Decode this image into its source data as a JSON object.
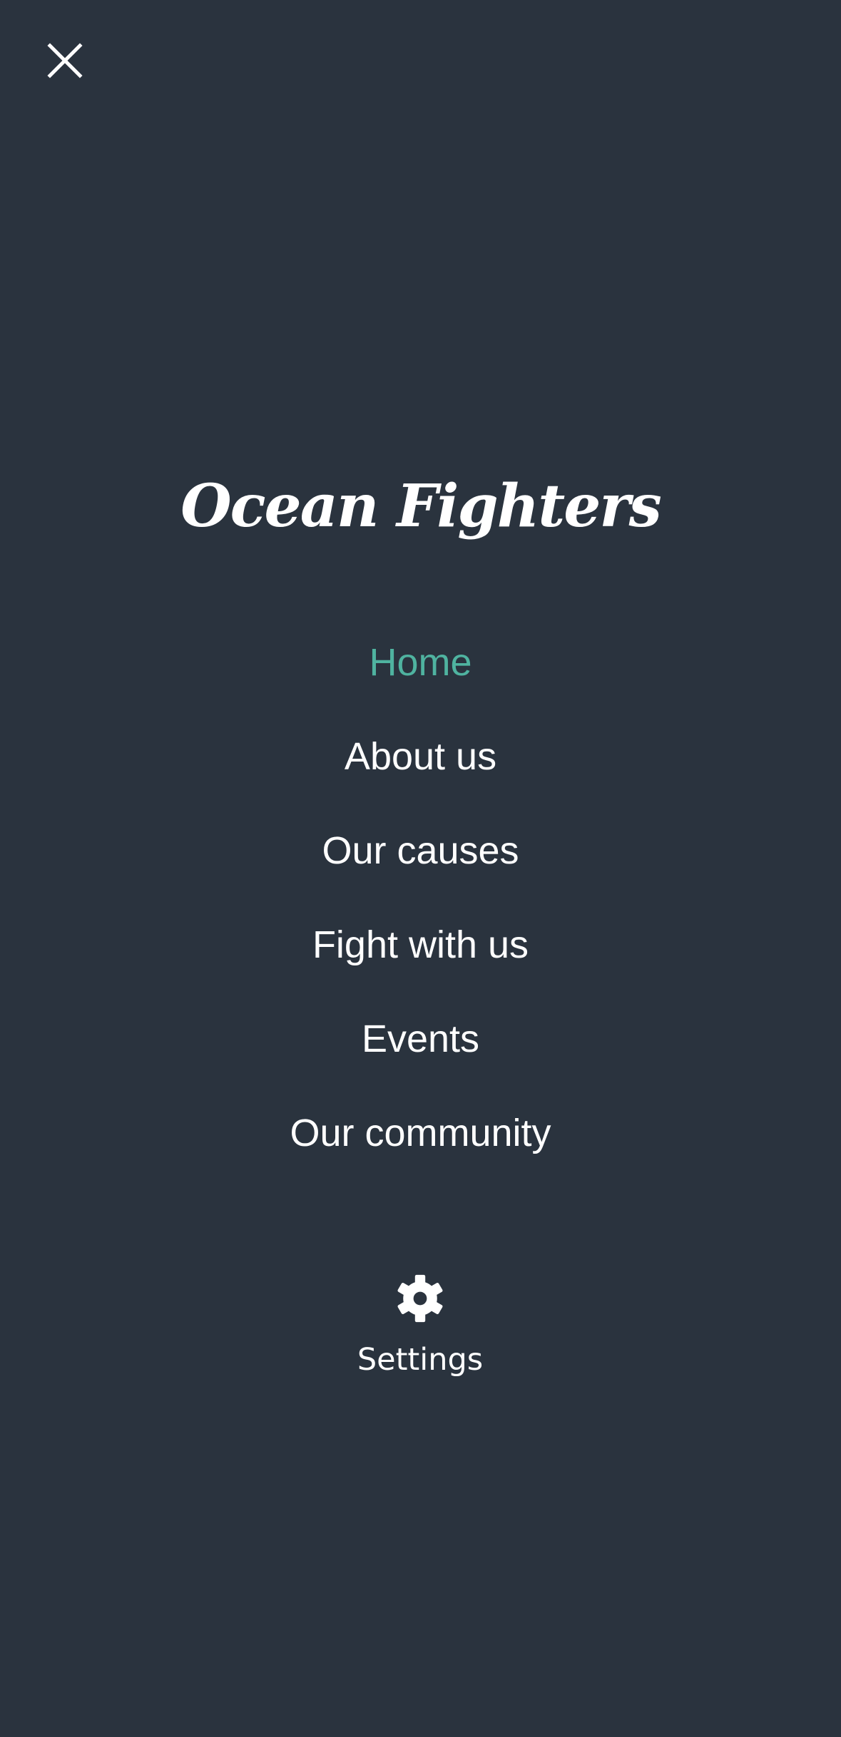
{
  "brand": {
    "name": "Ocean Fighters"
  },
  "nav": {
    "items": [
      {
        "label": "Home",
        "active": true
      },
      {
        "label": "About us"
      },
      {
        "label": "Our causes"
      },
      {
        "label": "Fight with us"
      },
      {
        "label": "Events"
      },
      {
        "label": "Our community"
      }
    ]
  },
  "settings": {
    "label": "Settings",
    "icon": "gear-icon"
  },
  "close": {
    "icon": "close-icon"
  },
  "colors": {
    "background": "#2a333e",
    "accent": "#4fb3a0",
    "text": "#ffffff"
  }
}
